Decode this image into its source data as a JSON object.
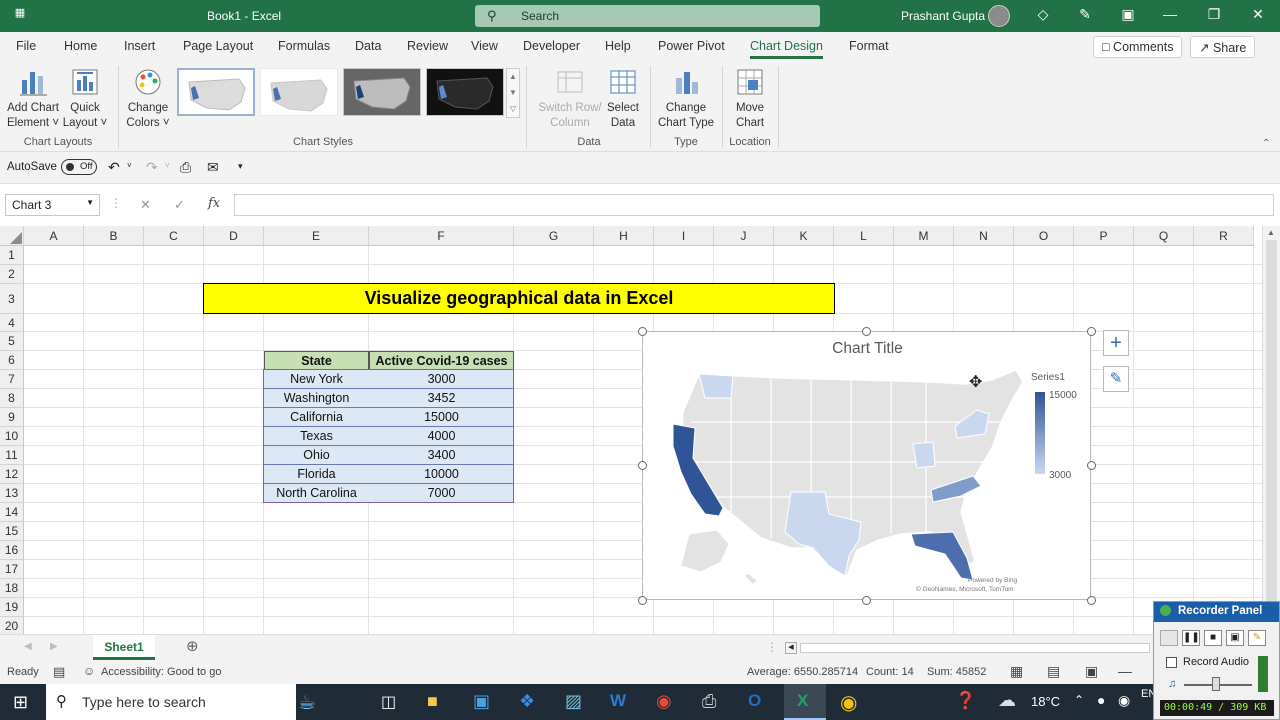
{
  "titlebar": {
    "doc_title": "Book1  -  Excel",
    "search_placeholder": "Search",
    "user_name": "Prashant Gupta"
  },
  "tabs": [
    "File",
    "Home",
    "Insert",
    "Page Layout",
    "Formulas",
    "Data",
    "Review",
    "View",
    "Developer",
    "Help",
    "Power Pivot",
    "Chart Design",
    "Format"
  ],
  "active_tab": "Chart Design",
  "comments_label": "Comments",
  "share_label": "Share",
  "ribbon": {
    "add_chart_element": [
      "Add Chart",
      "Element ˅"
    ],
    "quick_layout": [
      "Quick",
      "Layout ˅"
    ],
    "change_colors": [
      "Change",
      "Colors ˅"
    ],
    "switch_row_column": [
      "Switch Row/",
      "Column"
    ],
    "select_data": [
      "Select",
      "Data"
    ],
    "change_chart_type": [
      "Change",
      "Chart Type"
    ],
    "move_chart": [
      "Move",
      "Chart"
    ],
    "groups": {
      "chart_layouts": "Chart Layouts",
      "chart_styles": "Chart Styles",
      "data": "Data",
      "type": "Type",
      "location": "Location"
    }
  },
  "qat": {
    "autosave": "AutoSave",
    "toggle": "Off"
  },
  "formula_bar": {
    "name_box": "Chart 3",
    "fx": "fx",
    "formula": ""
  },
  "columns": [
    "A",
    "B",
    "C",
    "D",
    "E",
    "F",
    "G",
    "H",
    "I",
    "J",
    "K",
    "L",
    "M",
    "N",
    "O",
    "P",
    "Q",
    "R"
  ],
  "rows": [
    "1",
    "2",
    "3",
    "4",
    "5",
    "6",
    "7",
    "8",
    "9",
    "10",
    "11",
    "12",
    "13",
    "14",
    "15",
    "16",
    "17",
    "18",
    "19",
    "20"
  ],
  "banner": "Visualize geographical data in Excel",
  "table": {
    "headers": [
      "State",
      "Active Covid-19 cases"
    ],
    "rows": [
      [
        "New York",
        "3000"
      ],
      [
        "Washington",
        "3452"
      ],
      [
        "California",
        "15000"
      ],
      [
        "Texas",
        "4000"
      ],
      [
        "Ohio",
        "3400"
      ],
      [
        "Florida",
        "10000"
      ],
      [
        "North Carolina",
        "7000"
      ]
    ]
  },
  "chart": {
    "title": "Chart Title",
    "legend_series": "Series1",
    "legend_max": "15000",
    "legend_min": "3000",
    "credit_1": "Powered by Bing",
    "credit_2": "© GeoNames, Microsoft, TomTom",
    "colors": {
      "max": "#2f5597",
      "min": "#c9d8ef",
      "empty": "#e3e3e3"
    }
  },
  "sheet_tab": "Sheet1",
  "status": {
    "ready": "Ready",
    "accessibility": "Accessibility: Good to go",
    "average": "Average: 6550.285714",
    "count": "Count: 14",
    "sum": "Sum: 45852"
  },
  "taskbar": {
    "search_placeholder": "Type here to search",
    "temperature": "18°C",
    "lang": "EN"
  },
  "recorder": {
    "title": "Recorder Panel",
    "record_audio": "Record Audio",
    "timer": "00:00:49 / 309 KB"
  }
}
